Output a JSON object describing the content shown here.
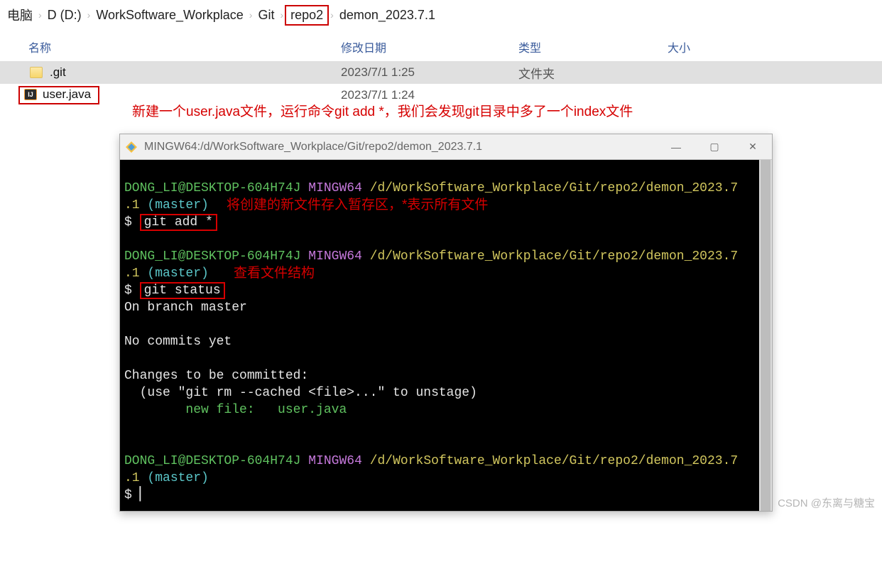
{
  "breadcrumb": {
    "items": [
      "电脑",
      "D (D:)",
      "WorkSoftware_Workplace",
      "Git",
      "repo2",
      "demon_2023.7.1"
    ],
    "highlighted_index": 4
  },
  "file_list": {
    "headers": {
      "name": "名称",
      "date": "修改日期",
      "type": "类型",
      "size": "大小"
    },
    "rows": [
      {
        "icon": "folder",
        "name": ".git",
        "date": "2023/7/1 1:25",
        "type": "文件夹",
        "size": "",
        "selected": true
      },
      {
        "icon": "java",
        "name": "user.java",
        "date": "2023/7/1 1:24",
        "type": "",
        "size": "",
        "boxed": true,
        "under": "运行命令git add *"
      }
    ]
  },
  "annotation1": "新建一个user.java文件，运行命令git add *，我们会发现git目录中多了一个index文件",
  "terminal": {
    "title": "MINGW64:/d/WorkSoftware_Workplace/Git/repo2/demon_2023.7.1",
    "prompt": {
      "user": "DONG_LI@DESKTOP-604H74J",
      "env": "MINGW64",
      "path": "/d/WorkSoftware_Workplace/Git/repo2/demon_2023.7",
      "tail": ".1",
      "branch": "(master)"
    },
    "cmd1": "git add *",
    "annot_cmd1": "将创建的新文件存入暂存区，*表示所有文件",
    "cmd2": "git status",
    "annot_cmd2": "查看文件结构",
    "out": {
      "l1": "On branch master",
      "l2": "No commits yet",
      "l3": "Changes to be committed:",
      "l4": "  (use \"git rm --cached <file>...\" to unstage)",
      "l5": "        new file:   user.java"
    },
    "dollar": "$"
  },
  "watermark": "CSDN @东离与糖宝"
}
